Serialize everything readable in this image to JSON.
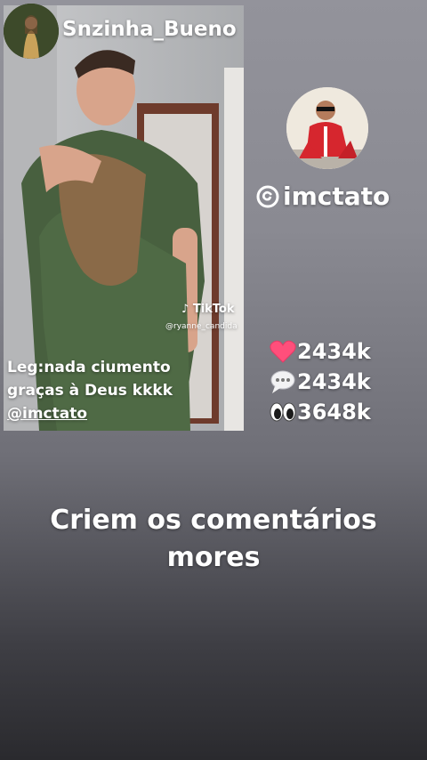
{
  "header": {
    "username": "Snzinha_Bueno"
  },
  "post": {
    "caption_line1": "Leg:nada ciumento",
    "caption_line2": "graças à Deus kkkk",
    "caption_handle": "@imctato",
    "watermark_brand": "TikTok",
    "watermark_user": "@ryanne_candida"
  },
  "profile": {
    "threads_handle": "imctato"
  },
  "stats": [
    {
      "icon": "heart-icon",
      "value": "2434k"
    },
    {
      "icon": "speech-bubble-icon",
      "value": "2434k"
    },
    {
      "icon": "eyes-icon",
      "value": "3648k"
    }
  ],
  "cta": {
    "line1": "Criem os comentários",
    "line2": "mores"
  }
}
